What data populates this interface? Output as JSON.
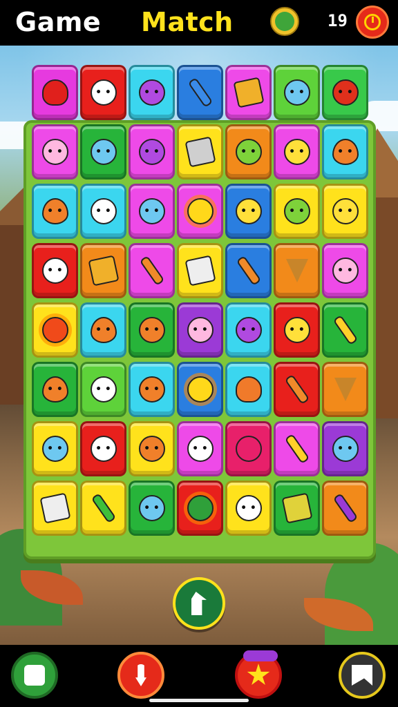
{
  "header": {
    "title_word1": "Game",
    "title_word2": "Match",
    "counter": "19"
  },
  "colors": {
    "title_yellow": "#ffe21c",
    "board_green": "#7ec63a",
    "tile_palette": [
      "magenta",
      "red",
      "cyan",
      "blue",
      "pink",
      "green",
      "yellow",
      "orange",
      "purple"
    ]
  },
  "board": {
    "columns": 7,
    "top_row": [
      {
        "color": "#e63adf",
        "icon": "red-heart-drop"
      },
      {
        "color": "#e8201c",
        "icon": "white-cat-face"
      },
      {
        "color": "#3bd6ef",
        "icon": "purple-blob-face"
      },
      {
        "color": "#2a7ee0",
        "icon": "blue-pencil"
      },
      {
        "color": "#ee4ae8",
        "icon": "spinning-top"
      },
      {
        "color": "#5ed23a",
        "icon": "blue-square-face"
      },
      {
        "color": "#38c94a",
        "icon": "red-fox-face"
      }
    ],
    "rows": [
      [
        {
          "color": "#ee4ae8",
          "icon": "pink-bunny-face"
        },
        {
          "color": "#27b43a",
          "icon": "blue-hair-face"
        },
        {
          "color": "#ee4ae8",
          "icon": "purple-blob-face"
        },
        {
          "color": "#ffe21c",
          "icon": "gear-wheel"
        },
        {
          "color": "#f28a1a",
          "icon": "green-lime-face"
        },
        {
          "color": "#ee4ae8",
          "icon": "yellow-pup-face"
        },
        {
          "color": "#3bd6ef",
          "icon": "orange-flame-face"
        }
      ],
      [
        {
          "color": "#3bd6ef",
          "icon": "orange-flame-face"
        },
        {
          "color": "#3bd6ef",
          "icon": "white-ghost-face"
        },
        {
          "color": "#ee4ae8",
          "icon": "blue-hat-face"
        },
        {
          "color": "#ee4ae8",
          "icon": "yellow-sun-face"
        },
        {
          "color": "#2a7ee0",
          "icon": "yellow-blob-face"
        },
        {
          "color": "#ffe21c",
          "icon": "green-leaf-face"
        },
        {
          "color": "#ffe21c",
          "icon": "yellow-cat-face"
        }
      ],
      [
        {
          "color": "#e8201c",
          "icon": "white-ghost-face"
        },
        {
          "color": "#f28a1a",
          "icon": "spinning-top"
        },
        {
          "color": "#ee4ae8",
          "icon": "orange-pencil"
        },
        {
          "color": "#ffe21c",
          "icon": "phone-card"
        },
        {
          "color": "#2a7ee0",
          "icon": "orange-arrow"
        },
        {
          "color": "#f28a1a",
          "icon": "ice-cream-cone"
        },
        {
          "color": "#ee4ae8",
          "icon": "pink-blob-face"
        }
      ],
      [
        {
          "color": "#ffe21c",
          "icon": "red-sun"
        },
        {
          "color": "#3bd6ef",
          "icon": "orange-flame-face"
        },
        {
          "color": "#27b43a",
          "icon": "orange-fox-face"
        },
        {
          "color": "#9b3ad6",
          "icon": "pink-blob-face"
        },
        {
          "color": "#3bd6ef",
          "icon": "purple-orb-face"
        },
        {
          "color": "#e8201c",
          "icon": "yellow-blob-face"
        },
        {
          "color": "#27b43a",
          "icon": "yellow-pencil"
        }
      ],
      [
        {
          "color": "#27b43a",
          "icon": "orange-flame-face"
        },
        {
          "color": "#5ed23a",
          "icon": "white-round-face"
        },
        {
          "color": "#3bd6ef",
          "icon": "orange-fox-face"
        },
        {
          "color": "#2a7ee0",
          "icon": "yellow-sun-face"
        },
        {
          "color": "#3bd6ef",
          "icon": "orange-heart-face"
        },
        {
          "color": "#e8201c",
          "icon": "orange-pencil"
        },
        {
          "color": "#f28a1a",
          "icon": "ice-cream-cone"
        }
      ],
      [
        {
          "color": "#ffe21c",
          "icon": "blue-bear-face"
        },
        {
          "color": "#e8201c",
          "icon": "white-round-face"
        },
        {
          "color": "#ffe21c",
          "icon": "orange-cat-face"
        },
        {
          "color": "#ee4ae8",
          "icon": "white-ghost-face"
        },
        {
          "color": "#e8206a",
          "icon": "red-ring"
        },
        {
          "color": "#ee4ae8",
          "icon": "yellow-pencil"
        },
        {
          "color": "#9b3ad6",
          "icon": "blue-glasses-face"
        }
      ],
      [
        {
          "color": "#ffe21c",
          "icon": "phone-card"
        },
        {
          "color": "#ffe21c",
          "icon": "green-lightning"
        },
        {
          "color": "#27b43a",
          "icon": "blue-bird-face"
        },
        {
          "color": "#e8201c",
          "icon": "green-spiky-ball"
        },
        {
          "color": "#ffe21c",
          "icon": "white-ghost-face"
        },
        {
          "color": "#27b43a",
          "icon": "blue-gem-box"
        },
        {
          "color": "#f28a1a",
          "icon": "purple-pen"
        }
      ]
    ]
  },
  "play_button": {
    "icon": "up-arrow-icon"
  },
  "footer": {
    "buttons": [
      {
        "name": "green-shop",
        "icon": "shirt-icon"
      },
      {
        "name": "red-download",
        "icon": "down-arrow-icon"
      },
      {
        "name": "star-bonus",
        "icon": "star-icon"
      },
      {
        "name": "yellow-flag",
        "icon": "flag-icon"
      }
    ]
  }
}
